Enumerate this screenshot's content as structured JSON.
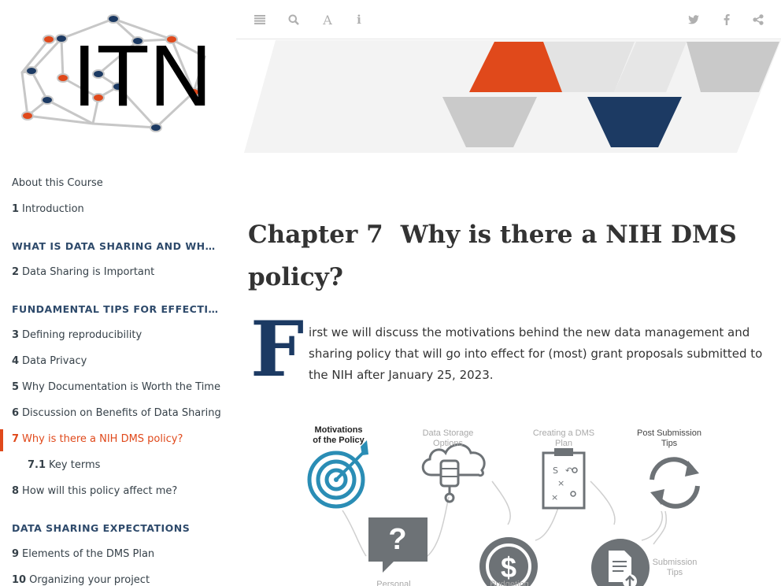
{
  "logo": {
    "text": "ITN"
  },
  "sidebar": {
    "items": [
      {
        "kind": "item",
        "num": "",
        "label": "About this Course"
      },
      {
        "kind": "item",
        "num": "1",
        "label": "Introduction"
      },
      {
        "kind": "part",
        "label": "WHAT IS DATA SHARING AND WHY IS IT IMPORTANT?"
      },
      {
        "kind": "item",
        "num": "2",
        "label": "Data Sharing is Important"
      },
      {
        "kind": "part",
        "label": "FUNDAMENTAL TIPS FOR EFFECTIVE DATA SHARING"
      },
      {
        "kind": "item",
        "num": "3",
        "label": "Defining reproducibility"
      },
      {
        "kind": "item",
        "num": "4",
        "label": "Data Privacy"
      },
      {
        "kind": "item",
        "num": "5",
        "label": "Why Documentation is Worth the Time"
      },
      {
        "kind": "item",
        "num": "6",
        "label": "Discussion on Benefits of Data Sharing"
      },
      {
        "kind": "item",
        "num": "7",
        "label": "Why is there a NIH DMS policy?",
        "active": true
      },
      {
        "kind": "sub",
        "num": "7.1",
        "label": "Key terms"
      },
      {
        "kind": "item",
        "num": "8",
        "label": "How will this policy affect me?"
      },
      {
        "kind": "part",
        "label": "DATA SHARING EXPECTATIONS"
      },
      {
        "kind": "item",
        "num": "9",
        "label": "Elements of the DMS Plan"
      },
      {
        "kind": "item",
        "num": "10",
        "label": "Organizing your project"
      }
    ]
  },
  "toolbar": {
    "left": [
      "hamburger-icon",
      "search-icon",
      "font-icon",
      "info-icon"
    ],
    "right": [
      "twitter-icon",
      "facebook-icon",
      "share-icon"
    ]
  },
  "main": {
    "chapter_number": "Chapter 7",
    "chapter_title": "Why is there a NIH DMS policy?",
    "dropcap": "F",
    "intro_text": "irst we will discuss the motivations behind the new data management and sharing policy that will go into effect for (most) grant proposals submitted to the NIH after January 25, 2023."
  },
  "diagram": {
    "labels": {
      "motivations_1": "Motivations",
      "motivations_2": "of the Policy",
      "storage_1": "Data Storage",
      "storage_2": "Options",
      "creating_1": "Creating a DMS",
      "creating_2": "Plan",
      "post_1": "Post Submission",
      "post_2": "Tips",
      "personal": "Personal",
      "budgeting": "Budgeting",
      "submission_1": "Submission",
      "submission_2": "Tips"
    }
  },
  "colors": {
    "accent_orange": "#e0491b",
    "navy": "#1c3a63",
    "teal": "#2a8db5",
    "gray": "#6d7276"
  }
}
